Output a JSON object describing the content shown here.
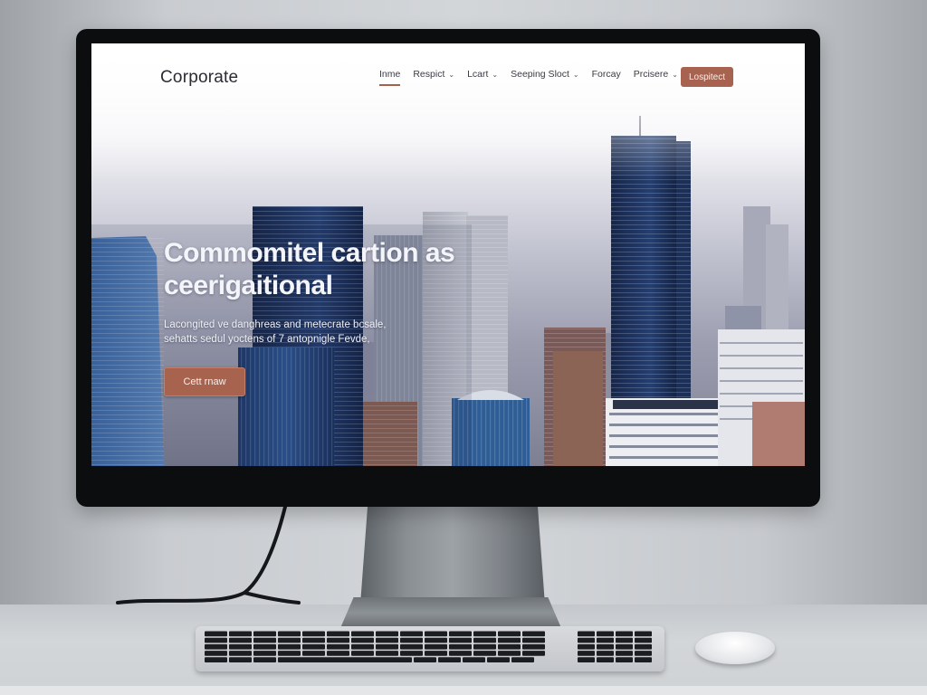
{
  "site": {
    "brand": "Corporate",
    "nav": [
      {
        "label": "Inme",
        "dropdown": false,
        "active": true
      },
      {
        "label": "Respict",
        "dropdown": true,
        "active": false
      },
      {
        "label": "Lcart",
        "dropdown": true,
        "active": false
      },
      {
        "label": "Seeping Sloct",
        "dropdown": true,
        "active": false
      },
      {
        "label": "Forcay",
        "dropdown": false,
        "active": false
      },
      {
        "label": "Prcisere",
        "dropdown": true,
        "active": false
      }
    ],
    "nav_cta": "Lospitect",
    "hero": {
      "title_line1": "Commomitel cartion as",
      "title_line2": "ceerigaitional",
      "subtitle_line1": "Lacongited ve danghreas and metecrate bcsale,",
      "subtitle_line2": "sehatts sedul yoctens of 7 antopnigle Fevde,",
      "cta": "Cett rnaw"
    }
  },
  "colors": {
    "accent": "#a8634e",
    "monitor_bezel": "#0c0d0f",
    "brand_text": "#2b2b33"
  },
  "icons": {
    "dropdown": "chevron-down-icon"
  }
}
